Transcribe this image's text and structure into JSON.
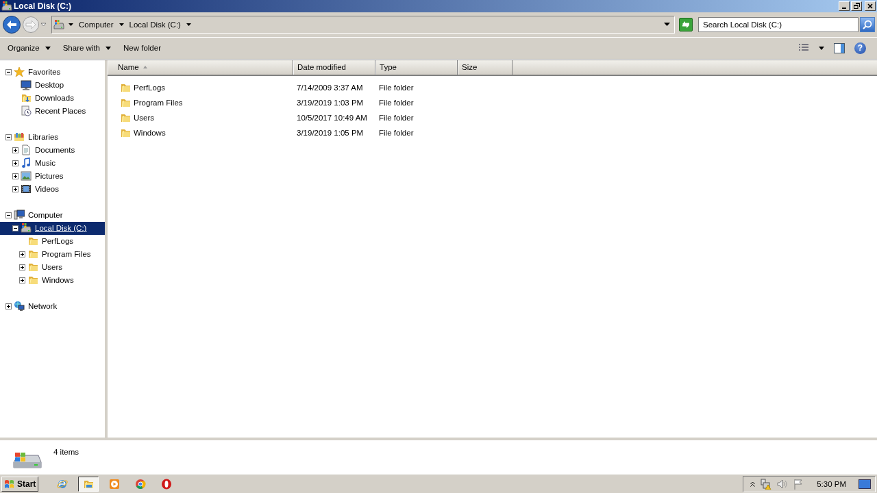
{
  "window": {
    "title": "Local Disk (C:)"
  },
  "address_bar": {
    "breadcrumbs": [
      "Computer",
      "Local Disk (C:)"
    ],
    "search": {
      "placeholder": "Search Local Disk (C:)"
    }
  },
  "toolbar": {
    "buttons": [
      {
        "label": "Organize",
        "dropdown": true
      },
      {
        "label": "Share with",
        "dropdown": true
      },
      {
        "label": "New folder",
        "dropdown": false
      }
    ],
    "help": "?"
  },
  "nav_tree": [
    {
      "label": "Favorites",
      "kind": "star",
      "expanded": true,
      "selected": false,
      "children": [
        {
          "label": "Desktop",
          "kind": "desktop",
          "selected": false
        },
        {
          "label": "Downloads",
          "kind": "downloads",
          "selected": false
        },
        {
          "label": "Recent Places",
          "kind": "recent",
          "selected": false
        }
      ]
    },
    {
      "label": "Libraries",
      "kind": "library",
      "expanded": true,
      "selected": false,
      "children": [
        {
          "label": "Documents",
          "kind": "document",
          "expanded": false,
          "selected": false
        },
        {
          "label": "Music",
          "kind": "music",
          "expanded": false,
          "selected": false
        },
        {
          "label": "Pictures",
          "kind": "pictures",
          "expanded": false,
          "selected": false
        },
        {
          "label": "Videos",
          "kind": "video",
          "expanded": false,
          "selected": false
        }
      ]
    },
    {
      "label": "Computer",
      "kind": "computer",
      "expanded": true,
      "selected": false,
      "children": [
        {
          "label": "Local Disk (C:)",
          "kind": "drive",
          "expanded": true,
          "selected": true,
          "children": [
            {
              "label": "PerfLogs",
              "kind": "folder",
              "selected": false
            },
            {
              "label": "Program Files",
              "kind": "folder",
              "expanded": false,
              "selected": false
            },
            {
              "label": "Users",
              "kind": "folder",
              "expanded": false,
              "selected": false
            },
            {
              "label": "Windows",
              "kind": "folder",
              "expanded": false,
              "selected": false
            }
          ]
        }
      ]
    },
    {
      "label": "Network",
      "kind": "network",
      "expanded": false,
      "selected": false
    }
  ],
  "file_list": {
    "columns": [
      {
        "label": "Name",
        "sorted": true
      },
      {
        "label": "Date modified",
        "sorted": false
      },
      {
        "label": "Type",
        "sorted": false
      },
      {
        "label": "Size",
        "sorted": false
      }
    ],
    "rows": [
      {
        "cells": [
          "PerfLogs",
          "7/14/2009 3:37 AM",
          "File folder"
        ],
        "selected": false
      },
      {
        "cells": [
          "Program Files",
          "3/19/2019 1:03 PM",
          "File folder"
        ],
        "selected": false
      },
      {
        "cells": [
          "Users",
          "10/5/2017 10:49 AM",
          "File folder"
        ],
        "selected": false
      },
      {
        "cells": [
          "Windows",
          "3/19/2019 1:05 PM",
          "File folder"
        ],
        "selected": false
      }
    ]
  },
  "status_bar": {
    "text": "4 items"
  },
  "taskbar": {
    "start": "Start",
    "apps": [
      {
        "kind": "browser-e",
        "selected": false
      },
      {
        "kind": "explorer",
        "selected": true
      },
      {
        "kind": "media",
        "selected": false
      },
      {
        "kind": "chrome",
        "selected": false
      },
      {
        "kind": "opera",
        "selected": false
      }
    ],
    "clock": "5:30 PM"
  }
}
